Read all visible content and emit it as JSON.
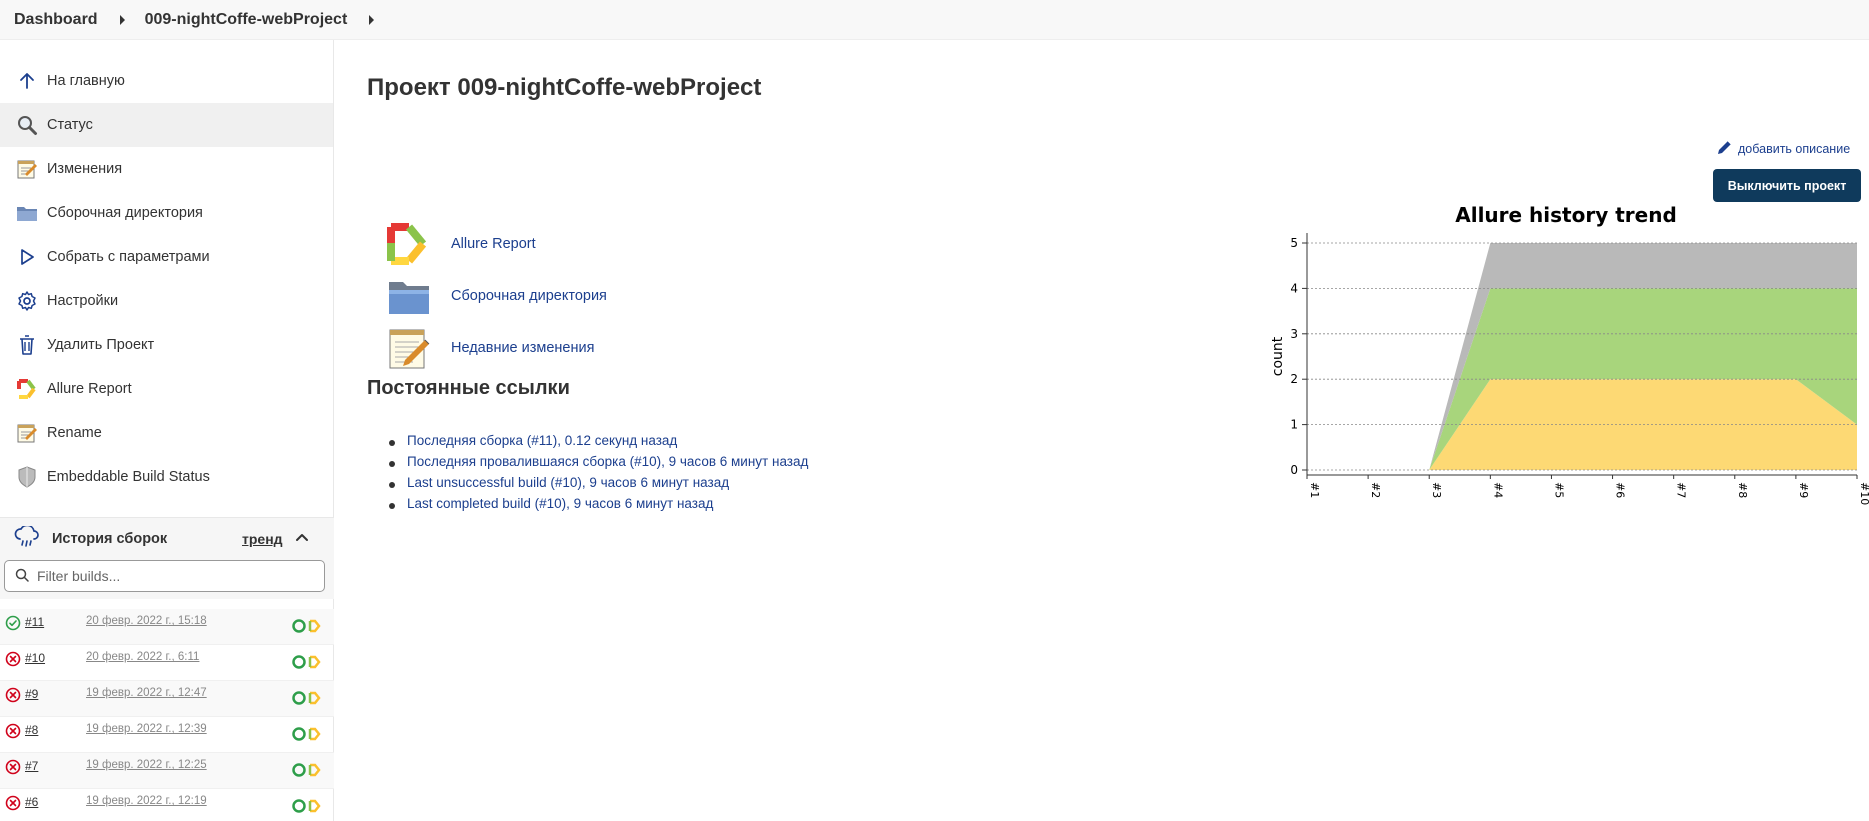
{
  "breadcrumb": {
    "items": [
      "Dashboard",
      "009-nightCoffe-webProject"
    ]
  },
  "sidebar": {
    "tasks": [
      {
        "label": "На главную",
        "icon": "arrow-up-icon"
      },
      {
        "label": "Статус",
        "icon": "search-icon"
      },
      {
        "label": "Изменения",
        "icon": "notepad-icon"
      },
      {
        "label": "Сборочная директория",
        "icon": "folder-icon"
      },
      {
        "label": "Собрать с параметрами",
        "icon": "play-icon"
      },
      {
        "label": "Настройки",
        "icon": "gear-icon"
      },
      {
        "label": "Удалить Проект",
        "icon": "trash-icon"
      },
      {
        "label": "Allure Report",
        "icon": "allure-icon"
      },
      {
        "label": "Rename",
        "icon": "notepad-icon"
      },
      {
        "label": "Embeddable Build Status",
        "icon": "shield-icon"
      }
    ]
  },
  "build_history": {
    "title": "История сборок",
    "trend_label": "тренд",
    "filter_placeholder": "Filter builds...",
    "builds": [
      {
        "number": "#11",
        "date": "20 февр. 2022 г., 15:18",
        "status": "success"
      },
      {
        "number": "#10",
        "date": "20 февр. 2022 г., 6:11",
        "status": "failed"
      },
      {
        "number": "#9",
        "date": "19 февр. 2022 г., 12:47",
        "status": "failed"
      },
      {
        "number": "#8",
        "date": "19 февр. 2022 г., 12:39",
        "status": "failed"
      },
      {
        "number": "#7",
        "date": "19 февр. 2022 г., 12:25",
        "status": "failed"
      },
      {
        "number": "#6",
        "date": "19 февр. 2022 г., 12:19",
        "status": "failed"
      }
    ]
  },
  "main": {
    "title": "Проект 009-nightCoffe-webProject",
    "add_description": "добавить описание",
    "disable_button": "Выключить проект",
    "links": [
      {
        "label": "Allure Report",
        "icon": "allure-icon"
      },
      {
        "label": "Сборочная директория",
        "icon": "folder-icon"
      },
      {
        "label": "Недавние изменения",
        "icon": "notepad-icon"
      }
    ],
    "permalinks_title": "Постоянные ссылки",
    "permalinks": [
      "Последняя сборка (#11), 0.12 секунд назад",
      "Последняя провалившаяся сборка (#10), 9 часов 6 минут назад",
      "Last unsuccessful build (#10), 9 часов 6 минут назад",
      "Last completed build (#10), 9 часов 6 минут назад"
    ]
  },
  "chart_data": {
    "type": "area",
    "title": "Allure history trend",
    "ylabel": "count",
    "xlabel": "",
    "categories": [
      "#1",
      "#2",
      "#3",
      "#4",
      "#5",
      "#6",
      "#7",
      "#8",
      "#9",
      "#10"
    ],
    "ylim": [
      0,
      5
    ],
    "yticks": [
      0,
      1,
      2,
      3,
      4,
      5
    ],
    "grid": true,
    "stacked": true,
    "series": [
      {
        "values": [
          0,
          0,
          0,
          2,
          2,
          2,
          2,
          2,
          2,
          1
        ],
        "color": "#fdd974"
      },
      {
        "values": [
          0,
          0,
          0,
          2,
          2,
          2,
          2,
          2,
          2,
          3
        ],
        "color": "#a8d57c"
      },
      {
        "values": [
          0,
          0,
          0,
          1,
          1,
          1,
          1,
          1,
          1,
          1
        ],
        "color": "#b9b9b9"
      }
    ]
  },
  "colors": {
    "link": "#1c3f8e",
    "primary_button": "#0f3a5c",
    "success": "#2e9e4a",
    "failed": "#d0021b"
  }
}
